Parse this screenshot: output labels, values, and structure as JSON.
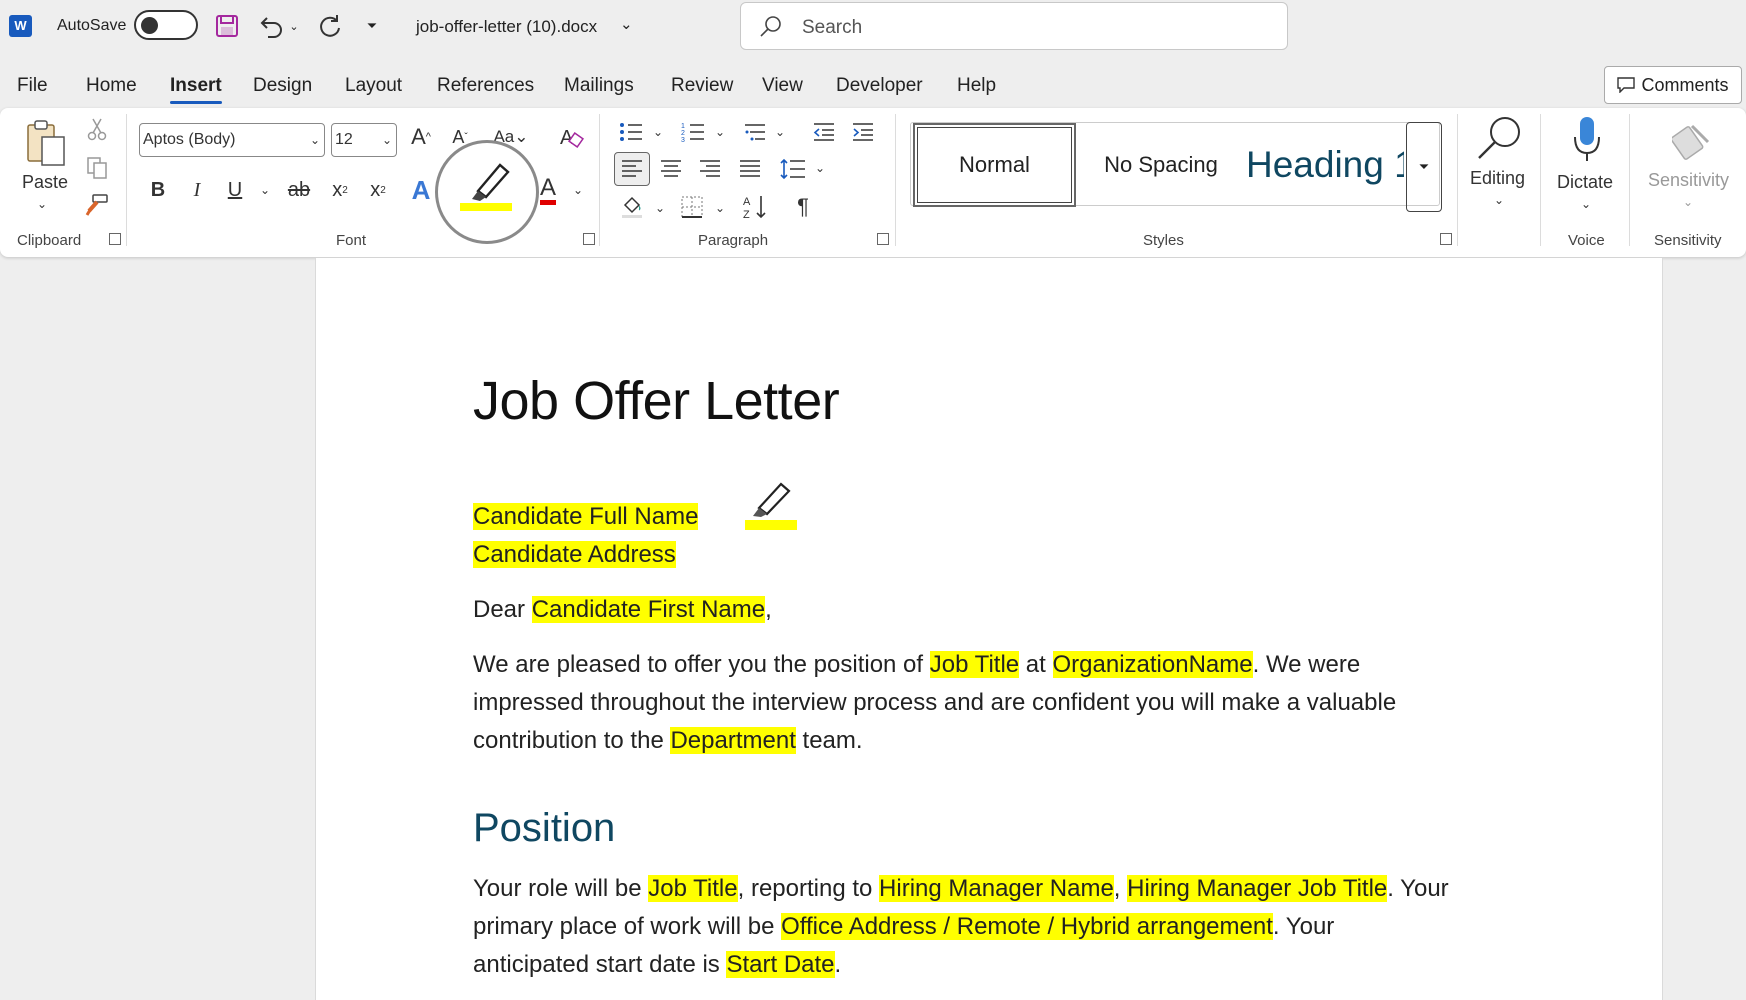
{
  "titlebar": {
    "autosave_label": "AutoSave",
    "doc_name": "job-offer-letter (10).docx",
    "search_placeholder": "Search"
  },
  "menu": {
    "tabs": [
      "File",
      "Home",
      "Insert",
      "Design",
      "Layout",
      "References",
      "Mailings",
      "Review",
      "View",
      "Developer",
      "Help"
    ],
    "active_tab": "Insert",
    "comments_label": "Comments"
  },
  "ribbon": {
    "clipboard": {
      "paste_label": "Paste",
      "group_label": "Clipboard"
    },
    "font": {
      "font_name": "Aptos (Body)",
      "font_size": "12",
      "group_label": "Font",
      "highlight_color": "#ffff00",
      "font_color": "#e00000"
    },
    "paragraph": {
      "group_label": "Paragraph"
    },
    "styles": {
      "items": [
        "Normal",
        "No Spacing",
        "Heading 1"
      ],
      "selected": "Normal",
      "group_label": "Styles"
    },
    "editing": {
      "label": "Editing"
    },
    "voice": {
      "label": "Dictate",
      "group_label": "Voice"
    },
    "sensitivity": {
      "label": "Sensitivity",
      "group_label": "Sensitivity"
    }
  },
  "document": {
    "title": "Job Offer Letter",
    "candidate_full_name": "Candidate Full Name",
    "candidate_address": "Candidate Address",
    "dear": "Dear ",
    "candidate_first_name": "Candidate First Name",
    "comma": ",",
    "p1_a": "We are pleased to offer you the position of ",
    "job_title": "Job Title",
    "p1_at": " at ",
    "organization_name": "OrganizationName",
    "p1_b": ". We were",
    "p1_line2": "impressed throughout the interview process and are confident you will make a valuable",
    "p1_line3_a": "contribution to the ",
    "department": "Department",
    "p1_line3_b": " team.",
    "heading_position": "Position",
    "p2_a": "Your role will be ",
    "p2_job_title": "Job Title",
    "p2_reporting": ", reporting to ",
    "hiring_manager_name": "Hiring Manager Name",
    "p2_sep": ", ",
    "hiring_manager_job_title": "Hiring Manager Job Title",
    "p2_your": ". Your",
    "p2_line2_a": "primary place of work will be ",
    "office_address": "Office Address / Remote / Hybrid arrangement",
    "p2_line2_b": ". Your",
    "p2_line3_a": "anticipated start date is ",
    "start_date": "Start Date",
    "p2_line3_b": "."
  }
}
